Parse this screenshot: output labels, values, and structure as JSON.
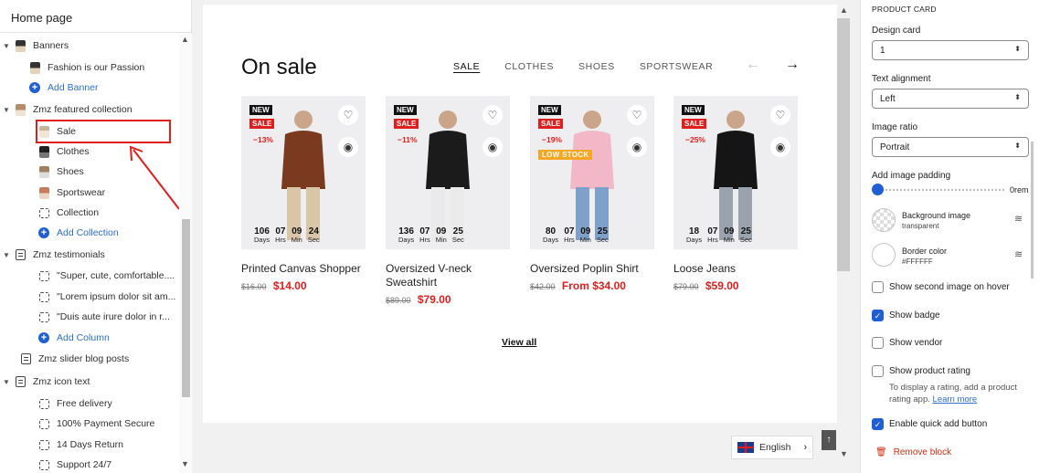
{
  "sidebar": {
    "title": "Home page",
    "items": [
      {
        "label": "Banners",
        "kind": "section",
        "icon": "image-thumb-icon"
      },
      {
        "label": "Fashion is our Passion",
        "kind": "block",
        "icon": "image-thumb-icon"
      },
      {
        "label": "Add Banner",
        "kind": "add"
      },
      {
        "label": "Zmz featured collection",
        "kind": "section",
        "icon": "image-thumb-icon"
      },
      {
        "label": "Sale",
        "kind": "block",
        "icon": "image-thumb-icon",
        "selected": true
      },
      {
        "label": "Clothes",
        "kind": "block",
        "icon": "image-thumb-icon"
      },
      {
        "label": "Shoes",
        "kind": "block",
        "icon": "image-thumb-icon"
      },
      {
        "label": "Sportswear",
        "kind": "block",
        "icon": "image-thumb-icon"
      },
      {
        "label": "Collection",
        "kind": "block",
        "icon": "block-outline-icon"
      },
      {
        "label": "Add Collection",
        "kind": "add"
      },
      {
        "label": "Zmz testimonials",
        "kind": "section",
        "icon": "section-icon"
      },
      {
        "label": "\"Super, cute, comfortable....",
        "kind": "block",
        "icon": "block-outline-icon"
      },
      {
        "label": "\"Lorem ipsum dolor sit am...",
        "kind": "block",
        "icon": "block-outline-icon"
      },
      {
        "label": "\"Duis aute irure dolor in r...",
        "kind": "block",
        "icon": "block-outline-icon"
      },
      {
        "label": "Add Column",
        "kind": "add"
      },
      {
        "label": "Zmz slider blog posts",
        "kind": "section",
        "icon": "blog-icon"
      },
      {
        "label": "Zmz icon text",
        "kind": "section",
        "icon": "section-icon"
      },
      {
        "label": "Free delivery",
        "kind": "block",
        "icon": "block-outline-icon"
      },
      {
        "label": "100% Payment Secure",
        "kind": "block",
        "icon": "block-outline-icon"
      },
      {
        "label": "14 Days Return",
        "kind": "block",
        "icon": "block-outline-icon"
      },
      {
        "label": "Support 24/7",
        "kind": "block",
        "icon": "block-outline-icon"
      }
    ]
  },
  "preview": {
    "section_title": "On sale",
    "tabs": [
      "SALE",
      "CLOTHES",
      "SHOES",
      "SPORTSWEAR"
    ],
    "active_tab": "SALE",
    "products": [
      {
        "name": "Printed Canvas Shopper",
        "old_price": "$16.00",
        "price": "$14.00",
        "badges": [
          "NEW",
          "SALE"
        ],
        "discount": "−13%",
        "low_stock": "",
        "timer": [
          [
            "106",
            "Days"
          ],
          [
            "07",
            "Hrs"
          ],
          [
            "09",
            "Min"
          ],
          [
            "24",
            "Sec"
          ]
        ],
        "colors": [
          "#7a3a1f",
          "#d9c6a8"
        ]
      },
      {
        "name": "Oversized V-neck Sweatshirt",
        "old_price": "$89.00",
        "price": "$79.00",
        "badges": [
          "NEW",
          "SALE"
        ],
        "discount": "−11%",
        "low_stock": "",
        "timer": [
          [
            "136",
            "Days"
          ],
          [
            "07",
            "Hrs"
          ],
          [
            "09",
            "Min"
          ],
          [
            "25",
            "Sec"
          ]
        ],
        "colors": [
          "#1b1b1b",
          "#eaeaea"
        ]
      },
      {
        "name": "Oversized Poplin Shirt",
        "old_price": "$42.00",
        "price": "From $34.00",
        "badges": [
          "NEW",
          "SALE"
        ],
        "discount": "−19%",
        "low_stock": "LOW STOCK",
        "timer": [
          [
            "80",
            "Days"
          ],
          [
            "07",
            "Hrs"
          ],
          [
            "09",
            "Min"
          ],
          [
            "25",
            "Sec"
          ]
        ],
        "colors": [
          "#f2b8c8",
          "#7fa1c9"
        ]
      },
      {
        "name": "Loose Jeans",
        "old_price": "$79.00",
        "price": "$59.00",
        "badges": [
          "NEW",
          "SALE"
        ],
        "discount": "−25%",
        "low_stock": "",
        "timer": [
          [
            "18",
            "Days"
          ],
          [
            "07",
            "Hrs"
          ],
          [
            "09",
            "Min"
          ],
          [
            "25",
            "Sec"
          ]
        ],
        "colors": [
          "#151515",
          "#9aa3ad"
        ]
      }
    ],
    "view_all": "View all",
    "language": "English"
  },
  "panel": {
    "heading": "PRODUCT CARD",
    "design_card_label": "Design card",
    "design_card_value": "1",
    "text_alignment_label": "Text alignment",
    "text_alignment_value": "Left",
    "image_ratio_label": "Image ratio",
    "image_ratio_value": "Portrait",
    "padding_label": "Add image padding",
    "padding_value": "0rem",
    "bg_image_label": "Background image",
    "bg_image_value": "transparent",
    "border_color_label": "Border color",
    "border_color_value": "#FFFFFF",
    "checkboxes": [
      {
        "label": "Show second image on hover",
        "checked": false
      },
      {
        "label": "Show badge",
        "checked": true
      },
      {
        "label": "Show vendor",
        "checked": false
      },
      {
        "label": "Show product rating",
        "checked": false
      },
      {
        "label": "Enable quick add button",
        "checked": true
      }
    ],
    "rating_help": "To display a rating, add a product rating app.",
    "rating_help_link": "Learn more",
    "remove_block": "Remove block"
  },
  "colors": {
    "accent": "#1f5fd3",
    "sale_red": "#e01e1e",
    "low_stock": "#f5a623",
    "highlight": "#e01e1e"
  }
}
